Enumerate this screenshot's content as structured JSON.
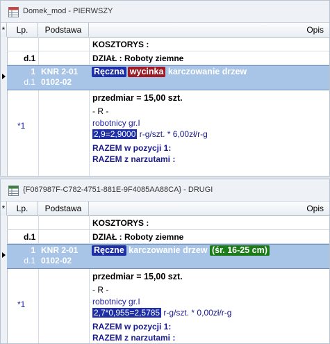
{
  "pane1": {
    "title": "Domek_mod - PIERWSZY",
    "columns": {
      "star": "*",
      "lp": "Lp.",
      "podstawa": "Podstawa",
      "opis": "Opis"
    },
    "rows": {
      "kosztorys": "KOSZTORYS :",
      "dzial_lp": "d.1",
      "dzial": "DZIAŁ :  Roboty ziemne",
      "item_lp": "1",
      "item_lp_sub": "d.1",
      "item_pod1": "KNR 2-01",
      "item_pod2": "0102-02",
      "item_tag1": "Ręczna",
      "item_tag2": "wycinka",
      "item_rest": "karczowanie drzew",
      "przedmiar": "przedmiar  =  15,00 szt.",
      "r": "- R -",
      "star_lp": "*1",
      "robotnicy": "robotnicy gr.I",
      "norma_val": "2,9=2,9000",
      "norma_rest": " r-g/szt. * 6,00zł/r-g",
      "razem": "RAZEM w pozycji 1:",
      "razem_narz": "RAZEM z narzutami :"
    }
  },
  "pane2": {
    "title": "{F067987F-C782-4751-881E-9F4085AA88CA} - DRUGI",
    "columns": {
      "star": "*",
      "lp": "Lp.",
      "podstawa": "Podstawa",
      "opis": "Opis"
    },
    "rows": {
      "kosztorys": "KOSZTORYS :",
      "dzial_lp": "d.1",
      "dzial": "DZIAŁ :  Roboty ziemne",
      "item_lp": "1",
      "item_lp_sub": "d.1",
      "item_pod1": "KNR 2-01",
      "item_pod2": "0102-02",
      "item_tag1": "Ręczne",
      "item_rest": "karczowanie drzew",
      "item_tag3": "(śr. 16-25 cm)",
      "przedmiar": "przedmiar  =  15,00 szt.",
      "r": "- R -",
      "star_lp": "*1",
      "robotnicy": "robotnicy gr.I",
      "norma_val": "2,7*0,955=2,5785",
      "norma_rest": " r-g/szt. * 0,00zł/r-g",
      "razem": "RAZEM w pozycji 1:",
      "razem_narz": "RAZEM z narzutami :"
    }
  },
  "colors": {
    "selection": "#a8c4e6",
    "chip_blue": "#1f2fa6",
    "chip_red": "#9c1b24",
    "chip_green": "#1c7d18",
    "text_navy": "#1a1a8c"
  }
}
